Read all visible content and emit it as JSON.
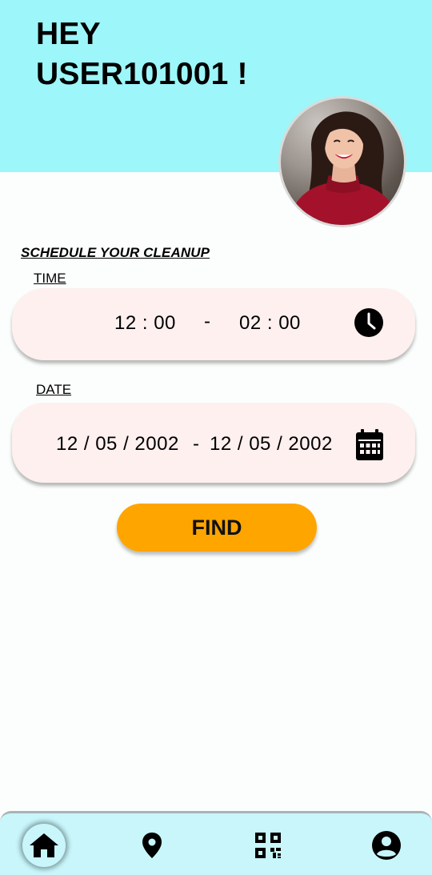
{
  "header": {
    "greeting_line1": "HEY",
    "greeting_line2": "USER101001 !",
    "background": "#9df6f9"
  },
  "schedule": {
    "title": "SCHEDULE YOUR CLEANUP",
    "time": {
      "label": "TIME",
      "start": "12 : 00",
      "separator": "-",
      "end": "02 : 00",
      "icon": "clock-icon"
    },
    "date": {
      "label": "DATE",
      "start": "12 / 05 / 2002",
      "separator": "-",
      "end": "12 / 05 / 2002",
      "icon": "calendar-icon"
    },
    "find_label": "FIND",
    "accent": "#ffa500",
    "pill_background": "#fdf0ef"
  },
  "bottom_nav": {
    "background": "#c8f6fb",
    "items": [
      {
        "name": "home",
        "icon": "home-icon",
        "active": true
      },
      {
        "name": "map",
        "icon": "location-pin-icon",
        "active": false
      },
      {
        "name": "qr",
        "icon": "qr-code-icon",
        "active": false
      },
      {
        "name": "profile",
        "icon": "account-circle-icon",
        "active": false
      }
    ]
  }
}
